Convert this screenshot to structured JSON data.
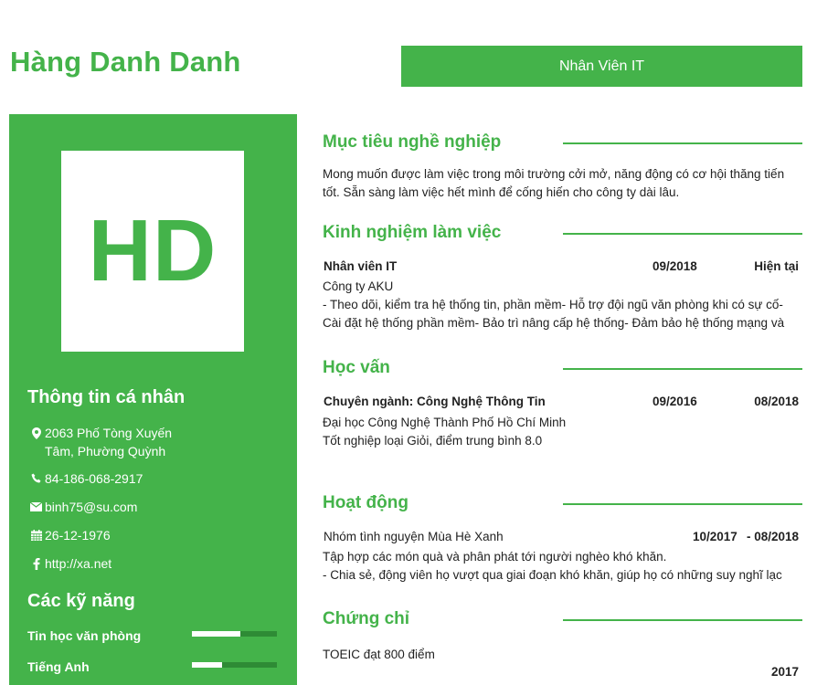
{
  "header": {
    "name": "Hàng Danh Danh",
    "position": "Nhân Viên IT"
  },
  "sidebar": {
    "avatar_initials": "HD",
    "personal_heading": "Thông tin cá nhân",
    "address": "2063 Phố Tòng Xuyến Tâm, Phường Quỳnh",
    "phone": "84-186-068-2917",
    "email": "binh75@su.com",
    "birthday": "26-12-1976",
    "website": "http://xa.net",
    "skills_heading": "Các kỹ năng",
    "skills": [
      {
        "name": "Tin học văn phòng",
        "level": 0.57
      },
      {
        "name": "Tiếng Anh",
        "level": 0.35
      }
    ],
    "colors": {
      "accent": "#44b34a",
      "bar_track": "#2e8b35"
    }
  },
  "objective": {
    "title": "Mục tiêu nghề nghiệp",
    "line1": "Mong muốn được làm việc trong môi trường cởi mở, năng động có cơ hội thăng tiến",
    "line2": "tốt. Sẵn sàng làm việc hết mình để cống hiến cho công ty dài lâu."
  },
  "experience": {
    "title": "Kinh nghiệm làm việc",
    "role": "Nhân viên IT",
    "start": "09/2018",
    "end": "Hiện tại",
    "company": "Công ty AKU",
    "desc1": "- Theo dõi, kiểm tra hệ thống tin, phần mềm- Hỗ trợ đội ngũ văn phòng khi có sự cố-",
    "desc2": "Cài đặt hệ thống phần mềm- Bảo trì nâng cấp hệ thống- Đảm bảo hệ thống mạng và"
  },
  "education": {
    "title": "Học vấn",
    "major": "Chuyên ngành: Công Nghệ Thông Tin",
    "start": "09/2016",
    "end": "08/2018",
    "school": "Đại học Công Nghệ Thành Phố Hồ Chí Minh",
    "result": "Tốt nghiệp loại Giỏi, điểm trung bình 8.0"
  },
  "activities": {
    "title": "Hoạt động",
    "org": "Nhóm tình nguyện Mùa Hè Xanh",
    "start": "10/2017",
    "end": "- 08/2018",
    "desc1": "Tập hợp các món quà và phân phát tới người nghèo khó khăn.",
    "desc2": "- Chia sẻ, động viên họ vượt qua giai đoạn khó khăn, giúp họ có những suy nghĩ lạc"
  },
  "certificates": {
    "title": "Chứng chỉ",
    "item": "TOEIC đạt 800 điểm",
    "year": "2017"
  }
}
